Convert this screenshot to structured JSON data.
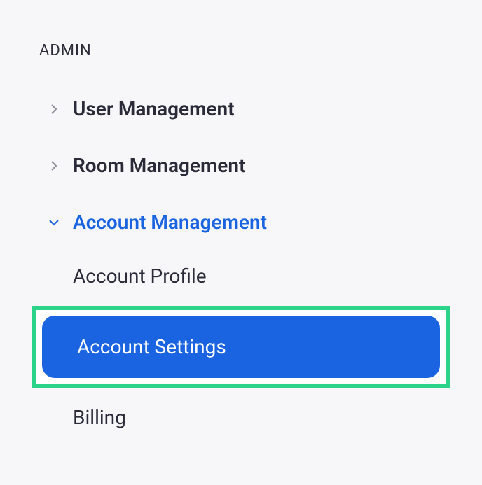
{
  "section": {
    "header": "ADMIN"
  },
  "nav": {
    "items": [
      {
        "label": "User Management",
        "expanded": false
      },
      {
        "label": "Room Management",
        "expanded": false
      },
      {
        "label": "Account Management",
        "expanded": true
      }
    ]
  },
  "subnav": {
    "items": [
      {
        "label": "Account Profile",
        "selected": false
      },
      {
        "label": "Account Settings",
        "selected": true
      },
      {
        "label": "Billing",
        "selected": false
      }
    ]
  }
}
